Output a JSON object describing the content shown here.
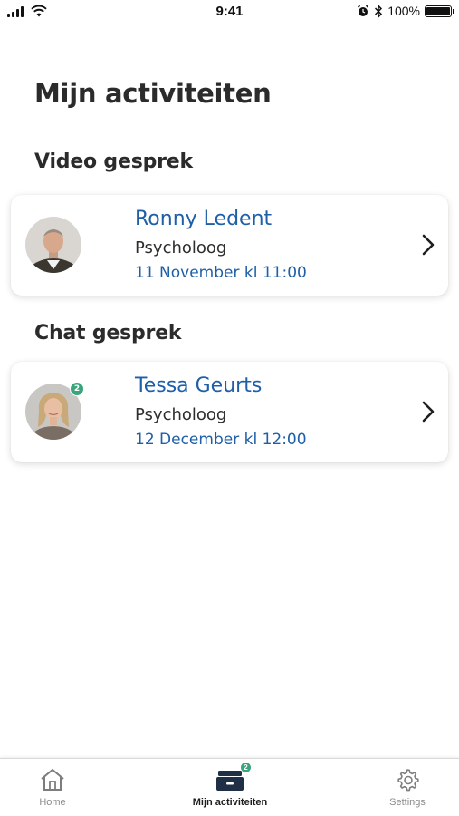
{
  "status_bar": {
    "time": "9:41",
    "battery_percent": "100%",
    "icons": [
      "signal-icon",
      "wifi-icon",
      "alarm-icon",
      "bluetooth-icon",
      "battery-icon"
    ]
  },
  "page": {
    "title": "Mijn activiteiten"
  },
  "sections": [
    {
      "title": "Video gesprek",
      "items": [
        {
          "name": "Ronny Ledent",
          "role": "Psycholoog",
          "date": "11 November kl 11:00",
          "badge": null
        }
      ]
    },
    {
      "title": "Chat gesprek",
      "items": [
        {
          "name": "Tessa Geurts",
          "role": "Psycholoog",
          "date": "12 December kl 12:00",
          "badge": "2"
        }
      ]
    }
  ],
  "tab_bar": {
    "home_label": "Home",
    "activities_label": "Mijn activiteiten",
    "activities_badge": "2",
    "settings_label": "Settings",
    "active_tab": "Mijn activiteiten"
  },
  "colors": {
    "accent_blue": "#1f5fa8",
    "badge_green": "#3aa57b",
    "title_text": "#2b2b2b"
  }
}
